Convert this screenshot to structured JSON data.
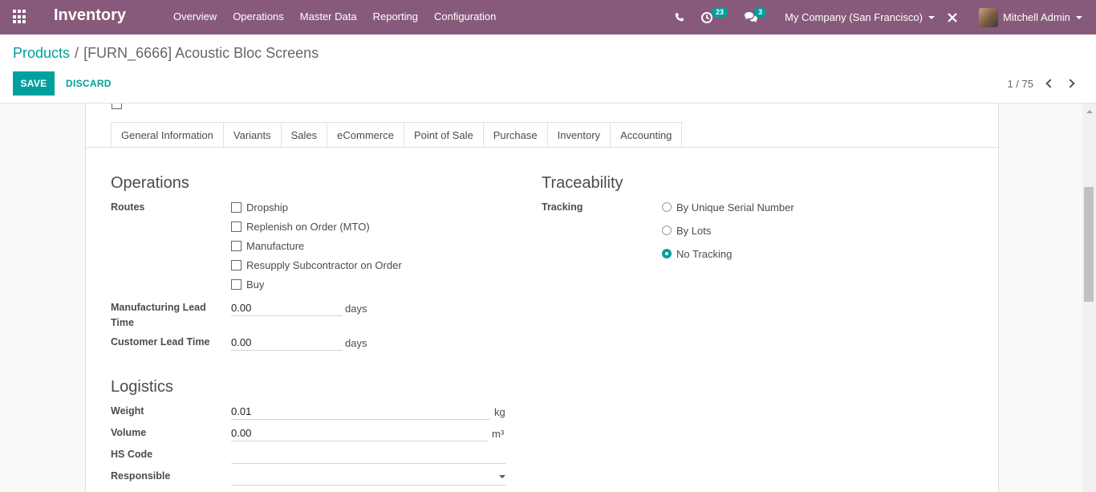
{
  "navbar": {
    "app_name": "Inventory",
    "menu": [
      "Overview",
      "Operations",
      "Master Data",
      "Reporting",
      "Configuration"
    ],
    "activity_count": "23",
    "message_count": "3",
    "company": "My Company (San Francisco)",
    "user": "Mitchell Admin",
    "colors": {
      "brand": "#875a7b",
      "accent": "#00a09d"
    }
  },
  "control": {
    "breadcrumb_parent": "Products",
    "breadcrumb_sep": "/",
    "breadcrumb_current": "[FURN_6666] Acoustic Bloc Screens",
    "save_label": "SAVE",
    "discard_label": "DISCARD",
    "pager": "1 / 75"
  },
  "tabs": [
    "General Information",
    "Variants",
    "Sales",
    "eCommerce",
    "Point of Sale",
    "Purchase",
    "Inventory",
    "Accounting"
  ],
  "active_tab": "Inventory",
  "operations": {
    "title": "Operations",
    "routes_label": "Routes",
    "routes": [
      {
        "label": "Dropship",
        "checked": false
      },
      {
        "label": "Replenish on Order (MTO)",
        "checked": false
      },
      {
        "label": "Manufacture",
        "checked": false
      },
      {
        "label": "Resupply Subcontractor on Order",
        "checked": false
      },
      {
        "label": "Buy",
        "checked": false
      }
    ],
    "mfg_lead_label_1": "Manufacturing Lead",
    "mfg_lead_label_2": "Time",
    "mfg_lead_value": "0.00",
    "customer_lead_label": "Customer Lead Time",
    "customer_lead_value": "0.00",
    "days_unit": "days"
  },
  "logistics": {
    "title": "Logistics",
    "weight_label": "Weight",
    "weight_value": "0.01",
    "weight_unit": "kg",
    "volume_label": "Volume",
    "volume_value": "0.00",
    "volume_unit": "m³",
    "hs_label": "HS Code",
    "hs_value": "",
    "responsible_label": "Responsible",
    "responsible_value": ""
  },
  "traceability": {
    "title": "Traceability",
    "tracking_label": "Tracking",
    "options": [
      {
        "label": "By Unique Serial Number",
        "checked": false
      },
      {
        "label": "By Lots",
        "checked": false
      },
      {
        "label": "No Tracking",
        "checked": true
      }
    ]
  }
}
